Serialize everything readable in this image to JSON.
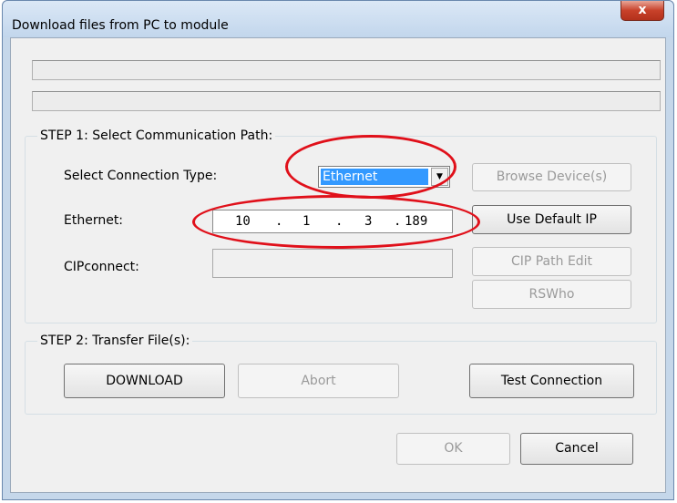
{
  "window": {
    "title": "Download files from PC to module",
    "close_glyph": "x"
  },
  "step1": {
    "label": "STEP 1: Select Communication Path:",
    "connection_type_label": "Select Connection Type:",
    "connection_type_value": "Ethernet",
    "browse_label": "Browse Device(s)",
    "ethernet_label": "Ethernet:",
    "ip_octets": [
      "10",
      "1",
      "3",
      "189"
    ],
    "use_default_ip_label": "Use Default IP",
    "cipconnect_label": "CIPconnect:",
    "cip_path_edit_label": "CIP Path Edit",
    "rswho_label": "RSWho"
  },
  "step2": {
    "label": "STEP 2: Transfer File(s):",
    "download_label": "DOWNLOAD",
    "abort_label": "Abort",
    "test_connection_label": "Test Connection"
  },
  "footer": {
    "ok_label": "OK",
    "cancel_label": "Cancel"
  },
  "colors": {
    "annotation": "#e0101a",
    "selection": "#3399ff"
  },
  "icons": {
    "combo_arrow": "chevron-down-icon",
    "close": "close-icon"
  }
}
